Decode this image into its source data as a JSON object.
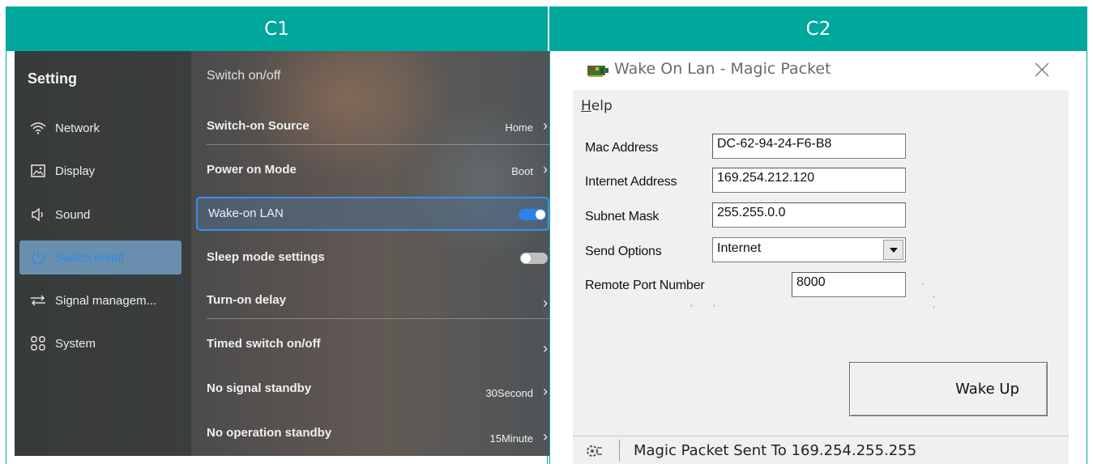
{
  "panels": {
    "left_label": "C1",
    "right_label": "C2"
  },
  "tv": {
    "sidebar_title": "Setting",
    "sidebar_items": [
      {
        "label": "Network",
        "icon": "wifi-icon"
      },
      {
        "label": "Display",
        "icon": "image-icon"
      },
      {
        "label": "Sound",
        "icon": "speaker-icon"
      },
      {
        "label": "Switch on/off",
        "icon": "power-icon",
        "active": true
      },
      {
        "label": "Signal managem...",
        "icon": "signal-switch-icon"
      },
      {
        "label": "System",
        "icon": "grid-icon"
      }
    ],
    "content_title": "Switch on/off",
    "rows": [
      {
        "label": "Switch-on Source",
        "value": "Home"
      },
      {
        "label": "Power on Mode",
        "value": "Boot"
      },
      {
        "label": "Wake-on LAN",
        "toggle": "on"
      },
      {
        "label": "Sleep mode settings",
        "toggle": "off"
      },
      {
        "label": "Turn-on delay",
        "value": ""
      },
      {
        "label": "Timed switch on/off",
        "value": ""
      },
      {
        "label": "No signal standby",
        "value": "30Second"
      },
      {
        "label": "No operation standby",
        "value": "15Minute"
      }
    ],
    "colors": {
      "accent": "#2f82e8",
      "highlight_border": "#3c8fe6"
    }
  },
  "dialog": {
    "title": "Wake On Lan - Magic Packet",
    "menu": {
      "help_hotkey": "H",
      "help_rest": "elp"
    },
    "fields": {
      "mac_label": "Mac Address",
      "mac_value": "DC-62-94-24-F6-B8",
      "ip_label": "Internet Address",
      "ip_value": "169.254.212.120",
      "subnet_label": "Subnet Mask",
      "subnet_value": "255.255.0.0",
      "send_label": "Send Options",
      "send_value": "Internet",
      "port_label": "Remote Port Number",
      "port_value": "8000"
    },
    "wake_button": "Wake Up",
    "status_text": "Magic Packet Sent To 169.254.255.255",
    "colors": {
      "band": "#00a79d"
    }
  }
}
